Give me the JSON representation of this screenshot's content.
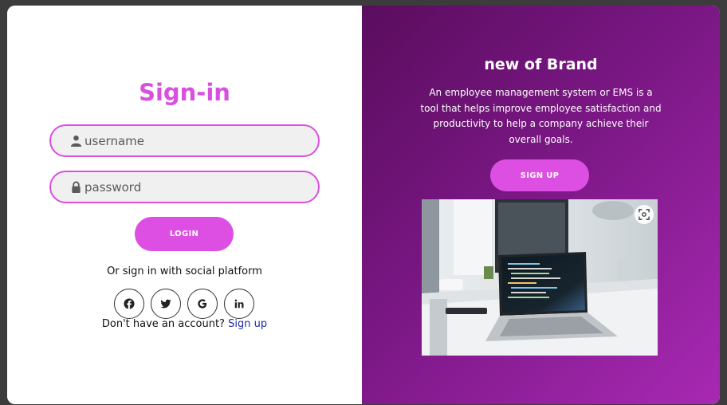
{
  "signin": {
    "title": "Sign-in",
    "username_placeholder": "username",
    "password_placeholder": "password",
    "login_label": "LOGIN",
    "social_text": "Or sign in with social platform",
    "socials": [
      "facebook-icon",
      "twitter-icon",
      "google-icon",
      "linkedin-icon"
    ],
    "no_account_text": "Don't have an account?",
    "signup_link": "Sign up"
  },
  "panel": {
    "brand": "new of Brand",
    "description": "An employee management system or EMS is a tool that helps improve employee satisfaction and productivity to help a company achieve their overall goals.",
    "signup_label": "SIGN UP"
  },
  "colors": {
    "accent": "#dd4fe3",
    "panel_dark": "#5a0d5e",
    "panel_light": "#a829b3",
    "link": "#1e2aa8"
  }
}
